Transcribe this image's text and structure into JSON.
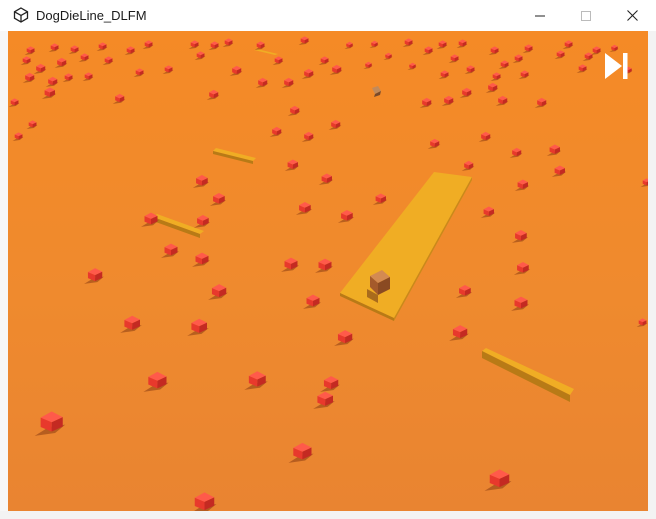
{
  "window": {
    "title": "DogDieLine_DLFM",
    "app_icon": "unity-icon",
    "controls": {
      "minimize_icon": "minimize-icon",
      "maximize_icon": "maximize-icon",
      "close_icon": "close-icon"
    }
  },
  "game": {
    "ground_color": "#ee8b2c",
    "cube_color": "#f04a3a",
    "platform_color": "#f2ae22",
    "player_color": "#b86a3a",
    "skip_button_icon": "skip-forward-icon"
  }
}
